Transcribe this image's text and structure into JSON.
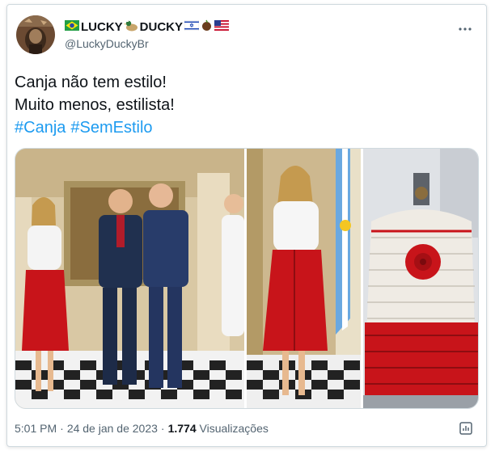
{
  "author": {
    "display_name_pre": "LUCKY",
    "display_name_mid": "DUCKY",
    "handle": "@LuckyDuckyBr",
    "avatar_icon": "avatar-rustic-portrait",
    "flags": [
      "flag-brazil-icon",
      "duck-emoji-icon",
      "flag-israel-icon",
      "coconut-emoji-icon",
      "flag-usa-icon"
    ]
  },
  "tweet": {
    "line1": "Canja não tem estilo!",
    "line2": "Muito menos, estilista!",
    "hashtag1": "#Canja",
    "hashtag2": "#SemEstilo"
  },
  "media": {
    "photos": [
      "photo-meeting-group",
      "photo-woman-red-skirt",
      "photo-crochet-gas-cylinder-cover"
    ]
  },
  "meta": {
    "time": "5:01 PM",
    "date": "24 de jan de 2023",
    "views_count": "1.774",
    "views_label": "Visualizações",
    "dot": "·"
  },
  "colors": {
    "accent": "#1d9bf0",
    "text": "#0f1419",
    "secondary": "#536471",
    "skirt_red": "#c8141a"
  }
}
